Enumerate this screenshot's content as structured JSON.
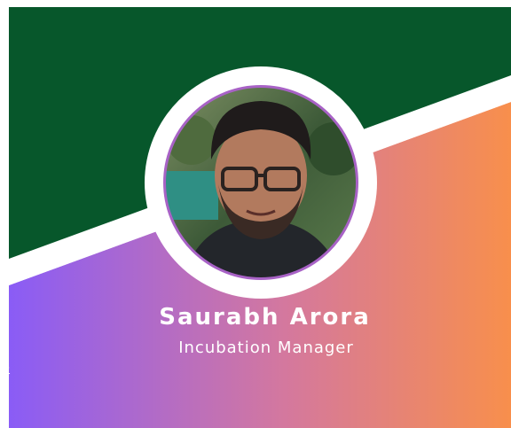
{
  "profile": {
    "name": "Saurabh Arora",
    "role": "Incubation Manager",
    "photo": "person-portrait"
  },
  "edge_link": {
    "text": "e"
  },
  "colors": {
    "top_band": "#07572b",
    "gradient_start": "#8a5cf6",
    "gradient_mid": "#d4789e",
    "gradient_end": "#f88f4c",
    "ring": "#ffffff"
  }
}
